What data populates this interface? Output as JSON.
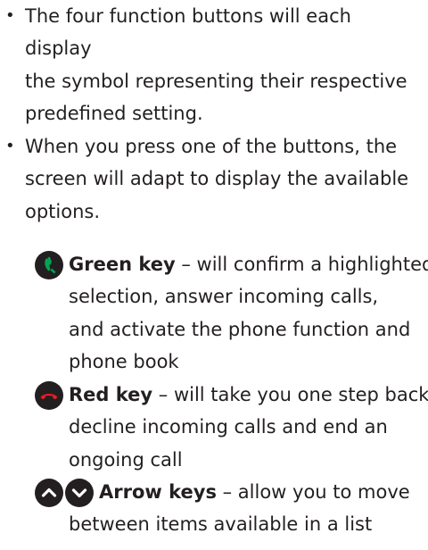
{
  "bullets": [
    {
      "lines": [
        "The four function buttons will each",
        "display",
        "the symbol representing their respective",
        "predefined setting."
      ]
    },
    {
      "lines": [
        "When you press one of the buttons, the",
        "screen will adapt to display the available",
        "options."
      ]
    }
  ],
  "keys": {
    "green": {
      "icon": "green-phone-key-icon",
      "title": "Green key",
      "first_line": " – will confirm a highlighted",
      "lines": [
        "selection, answer incoming calls,",
        "and activate the phone function and",
        "phone book"
      ]
    },
    "red": {
      "icon": "red-phone-key-icon",
      "title": "Red key",
      "first_line": " – will take you one step back,",
      "lines": [
        "decline incoming calls and end an",
        "ongoing call"
      ]
    },
    "arrows": {
      "icons": [
        "arrow-up-key-icon",
        "arrow-down-key-icon"
      ],
      "title": "Arrow keys",
      "first_line": " – allow you to move",
      "lines": [
        "between items available in a list"
      ]
    }
  },
  "colors": {
    "text": "#231f20",
    "icon_background": "#231f20",
    "green": "#00a651",
    "red": "#ed1c24",
    "white": "#ffffff"
  }
}
